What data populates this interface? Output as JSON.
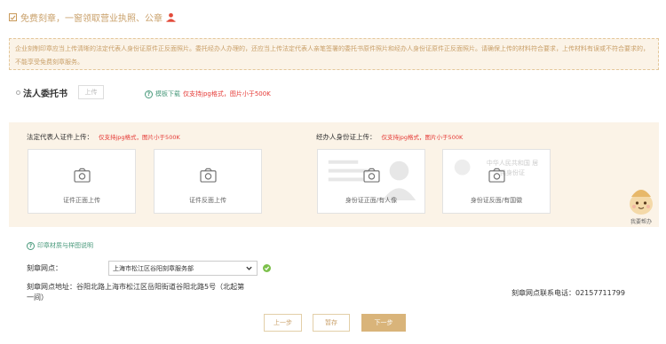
{
  "top": {
    "checkbox_label": "免费刻章，一窗领取营业执照、公章"
  },
  "notice": {
    "text": "企业刻制印章应当上传清晰的法定代表人身份证原件正反面照片。委托经办人办理的，还应当上传法定代表人亲笔签署的委托书原件照片和经办人身份证原件正反面照片。请确保上传的材料符合要求，上传材料有误或不符合要求的，不能享受免费刻章服务。"
  },
  "authorization": {
    "title": "法人委托书",
    "upload_label": "上传",
    "template_link": "模板下载",
    "template_hint": "仅支持jpg格式，图片小于500K"
  },
  "legal_rep": {
    "heading": "法定代表人证件上传：",
    "hint": "仅支持jpg格式，图片小于500K",
    "front_label": "证件正面上传",
    "back_label": "证件反面上传"
  },
  "agent": {
    "heading": "经办人身份证上传：",
    "hint": "仅支持jpg格式，图片小于500K",
    "front_label": "身份证正面/有人像",
    "back_label": "身份证反面/有国徽",
    "back_watermark": "中华人民共和国 居民身份证"
  },
  "helper": {
    "label": "我要帮办"
  },
  "material": {
    "link": "印章材质与样图说明"
  },
  "site": {
    "label": "刻章网点：",
    "selected": "上海市松江区谷阳刻章服务部",
    "address": "刻章网点地址：谷阳北路上海市松江区岳阳街道谷阳北路5号（北起第一间）",
    "contact": "刻章网点联系电话：02157711799"
  },
  "buttons": {
    "prev": "上一步",
    "save": "暂存",
    "next": "下一步"
  },
  "colors": {
    "accent": "#d9b47a",
    "panel_bg": "#fbf3e7",
    "link_green": "#4a9a7c",
    "hint_red": "#e53935"
  }
}
